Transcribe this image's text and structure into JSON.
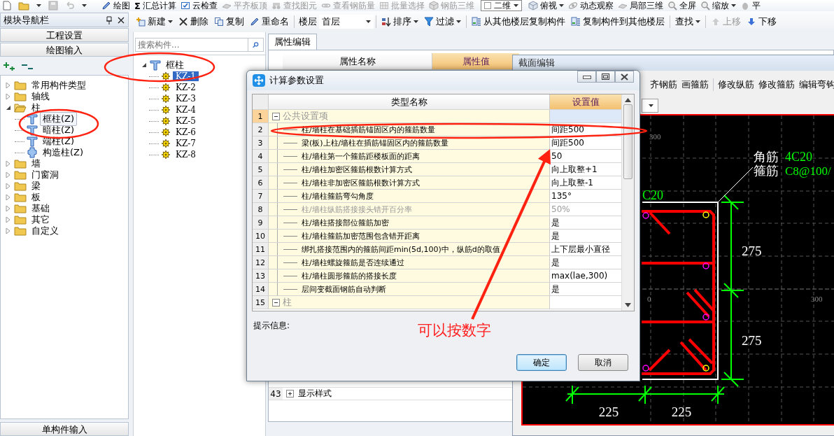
{
  "top_toolbar": {
    "items": [
      {
        "kind": "button",
        "label": "绘图",
        "disabled": false,
        "dropdown": false
      },
      {
        "kind": "button",
        "label": "汇总计算",
        "glyph": "Σ",
        "disabled": false,
        "dropdown": false
      },
      {
        "kind": "button",
        "label": "云检查",
        "disabled": false,
        "dropdown": false
      },
      {
        "kind": "button",
        "label": "平齐板顶",
        "disabled": true,
        "dropdown": false
      },
      {
        "kind": "button",
        "label": "查找图元",
        "disabled": true,
        "dropdown": false
      },
      {
        "kind": "button",
        "label": "查看钢筋量",
        "disabled": true,
        "dropdown": false
      },
      {
        "kind": "button",
        "label": "批量选择",
        "disabled": true,
        "dropdown": false
      },
      {
        "kind": "button",
        "label": "钢筋三维",
        "disabled": true,
        "dropdown": false
      },
      {
        "kind": "select",
        "value": "二维"
      },
      {
        "kind": "button",
        "label": "俯视",
        "disabled": false,
        "dropdown": true
      },
      {
        "kind": "button",
        "label": "动态观察",
        "disabled": false,
        "dropdown": false
      },
      {
        "kind": "button",
        "label": "局部三维",
        "disabled": false,
        "dropdown": false
      },
      {
        "kind": "button",
        "label": "全屏",
        "disabled": false,
        "dropdown": false
      },
      {
        "kind": "button",
        "label": "缩放",
        "disabled": false,
        "dropdown": true
      },
      {
        "kind": "button",
        "label": "平",
        "disabled": false,
        "dropdown": false
      }
    ]
  },
  "nav_panel": {
    "title": "模块导航栏",
    "buttons": [
      "工程设置",
      "绘图输入"
    ],
    "tree": [
      {
        "label": "常用构件类型",
        "expanded": false,
        "selected": false
      },
      {
        "label": "轴线",
        "expanded": false,
        "selected": false
      },
      {
        "label": "柱",
        "expanded": true,
        "selected": false,
        "children": [
          {
            "label": "框柱(Z)",
            "kind": "column",
            "selected": true
          },
          {
            "label": "暗柱(Z)",
            "kind": "column",
            "selected": false
          },
          {
            "label": "端柱(Z)",
            "kind": "column",
            "selected": false
          },
          {
            "label": "构造柱(Z)",
            "kind": "tie-column",
            "selected": false
          }
        ]
      },
      {
        "label": "墙",
        "expanded": false,
        "selected": false
      },
      {
        "label": "门窗洞",
        "expanded": false,
        "selected": false
      },
      {
        "label": "梁",
        "expanded": false,
        "selected": false
      },
      {
        "label": "板",
        "expanded": false,
        "selected": false
      },
      {
        "label": "基础",
        "expanded": false,
        "selected": false
      },
      {
        "label": "其它",
        "expanded": false,
        "selected": false
      },
      {
        "label": "自定义",
        "expanded": false,
        "selected": false
      }
    ],
    "footer": "单构件输入"
  },
  "component_toolbar": {
    "items": [
      {
        "kind": "button",
        "label": "新建",
        "dropdown": true,
        "disabled": false
      },
      {
        "kind": "button",
        "label": "删除",
        "dropdown": false,
        "disabled": false
      },
      {
        "kind": "button",
        "label": "复制",
        "dropdown": false,
        "disabled": false
      },
      {
        "kind": "button",
        "label": "重命名",
        "dropdown": false,
        "disabled": false
      },
      {
        "kind": "separator"
      },
      {
        "kind": "label",
        "label": "楼层"
      },
      {
        "kind": "select",
        "value": "首层"
      },
      {
        "kind": "separator"
      },
      {
        "kind": "button",
        "label": "排序",
        "dropdown": true,
        "disabled": false
      },
      {
        "kind": "button",
        "label": "过滤",
        "dropdown": true,
        "disabled": false
      },
      {
        "kind": "separator"
      },
      {
        "kind": "button",
        "label": "从其他楼层复制构件",
        "dropdown": false,
        "disabled": false
      },
      {
        "kind": "button",
        "label": "复制构件到其他楼层",
        "dropdown": false,
        "disabled": false
      },
      {
        "kind": "separator"
      },
      {
        "kind": "button",
        "label": "查找",
        "dropdown": true,
        "disabled": false
      },
      {
        "kind": "separator"
      },
      {
        "kind": "button",
        "label": "上移",
        "dropdown": false,
        "disabled": true
      },
      {
        "kind": "button",
        "label": "下移",
        "dropdown": false,
        "disabled": false
      }
    ]
  },
  "component_list": {
    "search_placeholder": "搜索构件...",
    "tree": [
      {
        "label": "框柱",
        "expanded": true,
        "selected": false,
        "children": [
          {
            "label": "KZ-1",
            "selected": true
          },
          {
            "label": "KZ-2",
            "selected": false
          },
          {
            "label": "KZ-3",
            "selected": false
          },
          {
            "label": "KZ-4",
            "selected": false
          },
          {
            "label": "KZ-5",
            "selected": false
          },
          {
            "label": "KZ-6",
            "selected": false
          },
          {
            "label": "KZ-7",
            "selected": false
          },
          {
            "label": "KZ-8",
            "selected": false
          }
        ]
      }
    ]
  },
  "property_panel": {
    "tab": "属性编辑",
    "columns": [
      "属性名称",
      "属性值"
    ],
    "rows": [
      {
        "number": "43",
        "label": "显示样式",
        "expanded": false
      }
    ]
  },
  "section_editor": {
    "title": "截面编辑",
    "tool_groups": [
      [
        "齐钢筋",
        "画箍筋"
      ],
      [
        "修改纵筋",
        "修改箍筋",
        "编辑弯钩"
      ]
    ],
    "drawing": {
      "corner_label": "角筋",
      "corner_spec": "4C20",
      "stirrup_label": "箍筋",
      "stirrup_spec": "C8@100/",
      "side_spec": "C20",
      "height_dims": [
        "275",
        "275"
      ],
      "width_dims": [
        "225",
        "225"
      ],
      "grid_labels": [
        "300",
        "0",
        "300"
      ]
    }
  },
  "dialog": {
    "title": "计算参数设置",
    "columns": [
      "类型名称",
      "设置值"
    ],
    "rows": [
      {
        "number": "1",
        "kind": "group",
        "name": "公共设置项",
        "expanded": true,
        "selected": true
      },
      {
        "number": "2",
        "kind": "item",
        "name": "柱/墙柱在基础插筋锚固区内的箍筋数量",
        "value": "间距500",
        "selected": false,
        "disabled": false
      },
      {
        "number": "3",
        "kind": "item",
        "name": "梁(板)上柱/墙柱在插筋锚固区内的箍筋数量",
        "value": "间距500",
        "selected": false,
        "disabled": false
      },
      {
        "number": "4",
        "kind": "item",
        "name": "柱/墙柱第一个箍筋距楼板面的距离",
        "value": "50",
        "selected": false,
        "disabled": false
      },
      {
        "number": "5",
        "kind": "item",
        "name": "柱/墙柱加密区箍筋根数计算方式",
        "value": "向上取整+1",
        "selected": false,
        "disabled": false
      },
      {
        "number": "6",
        "kind": "item",
        "name": "柱/墙柱非加密区箍筋根数计算方式",
        "value": "向上取整-1",
        "selected": false,
        "disabled": false
      },
      {
        "number": "7",
        "kind": "item",
        "name": "柱/墙柱箍筋弯勾角度",
        "value": "135°",
        "selected": false,
        "disabled": false
      },
      {
        "number": "8",
        "kind": "item",
        "name": "柱/墙柱纵筋搭接接头错开百分率",
        "value": "50%",
        "selected": false,
        "disabled": true
      },
      {
        "number": "9",
        "kind": "item",
        "name": "柱/墙柱搭接部位箍筋加密",
        "value": "是",
        "selected": false,
        "disabled": false
      },
      {
        "number": "10",
        "kind": "item",
        "name": "柱/墙柱箍筋加密范围包含错开距离",
        "value": "是",
        "selected": false,
        "disabled": false
      },
      {
        "number": "11",
        "kind": "item",
        "name": "绑扎搭接范围内的箍筋间距min(5d,100)中，纵筋d的取值",
        "value": "上下层最小直径",
        "selected": false,
        "disabled": false
      },
      {
        "number": "12",
        "kind": "item",
        "name": "柱/墙柱螺旋箍筋是否连续通过",
        "value": "是",
        "selected": false,
        "disabled": false
      },
      {
        "number": "13",
        "kind": "item",
        "name": "柱/墙柱圆形箍筋的搭接长度",
        "value": "max(lae,300)",
        "selected": false,
        "disabled": false
      },
      {
        "number": "14",
        "kind": "item",
        "name": "层间变截面钢筋自动判断",
        "value": "是",
        "selected": false,
        "disabled": false
      },
      {
        "number": "15",
        "kind": "group",
        "name": "柱",
        "expanded": true,
        "selected": false
      }
    ],
    "hint_label": "提示信息:",
    "buttons": [
      {
        "label": "确定",
        "default": true
      },
      {
        "label": "取消",
        "default": false
      }
    ]
  },
  "annotation": {
    "text": "可以按数字"
  }
}
